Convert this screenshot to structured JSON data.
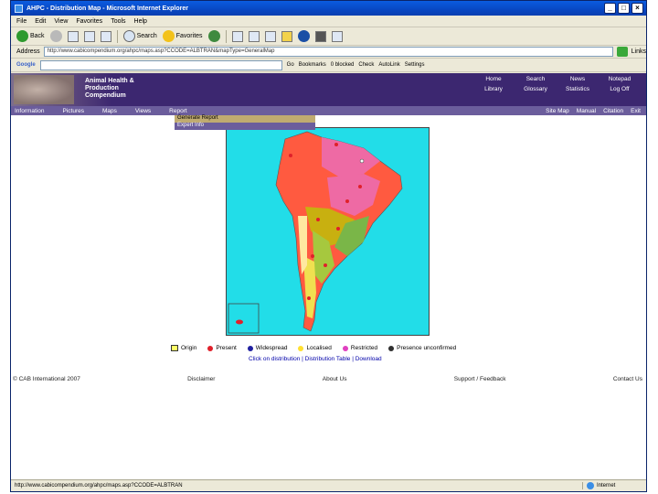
{
  "window": {
    "title": "AHPC - Distribution Map - Microsoft Internet Explorer"
  },
  "menu": [
    "File",
    "Edit",
    "View",
    "Favorites",
    "Tools",
    "Help"
  ],
  "toolbar": {
    "back": "Back",
    "search": "Search",
    "favorites": "Favorites"
  },
  "address": {
    "label": "Address",
    "url": "http://www.cabicompendium.org/ahpc/maps.asp?CCODE=ALBTRAN&mapType=GeneralMap",
    "go": "Go"
  },
  "google": {
    "label": "Google",
    "go": "Go",
    "bookmarks": "Bookmarks",
    "blocked": "0 blocked",
    "check": "Check",
    "autolink": "AutoLink",
    "settings": "Settings"
  },
  "banner": {
    "logo_line1": "Animal Health &",
    "logo_line2": "Production",
    "logo_line3": "Compendium"
  },
  "toplinks": [
    "Home",
    "Search",
    "News",
    "Notepad",
    "Library",
    "Glossary",
    "Statistics",
    "Log Off"
  ],
  "nav": {
    "left": [
      "Information",
      "Pictures",
      "Maps",
      "Views",
      "Report"
    ],
    "right": [
      "Site Map",
      "Manual",
      "Citation",
      "Exit"
    ]
  },
  "dropdown": [
    "Generate Report",
    "Expert Info"
  ],
  "legend": [
    "Origin",
    "Present",
    "Widespread",
    "Localised",
    "Restricted",
    "Presence unconfirmed"
  ],
  "legend_colors": {
    "origin": "#ffff66",
    "present": "#e0202a",
    "widespread": "#2020a0",
    "localised": "#ffe030",
    "restricted": "#e040c0",
    "unconfirmed": "#303030"
  },
  "map_links": {
    "text": "Click on distribution  |  Distribution Table  |  Download"
  },
  "footer": [
    "© CAB International 2007",
    "Disclaimer",
    "About Us",
    "Support / Feedback",
    "Contact Us"
  ],
  "status": {
    "url": "http://www.cabicompendium.org/ahpc/maps.asp?CCODE=ALBTRAN",
    "zone": "Internet"
  }
}
